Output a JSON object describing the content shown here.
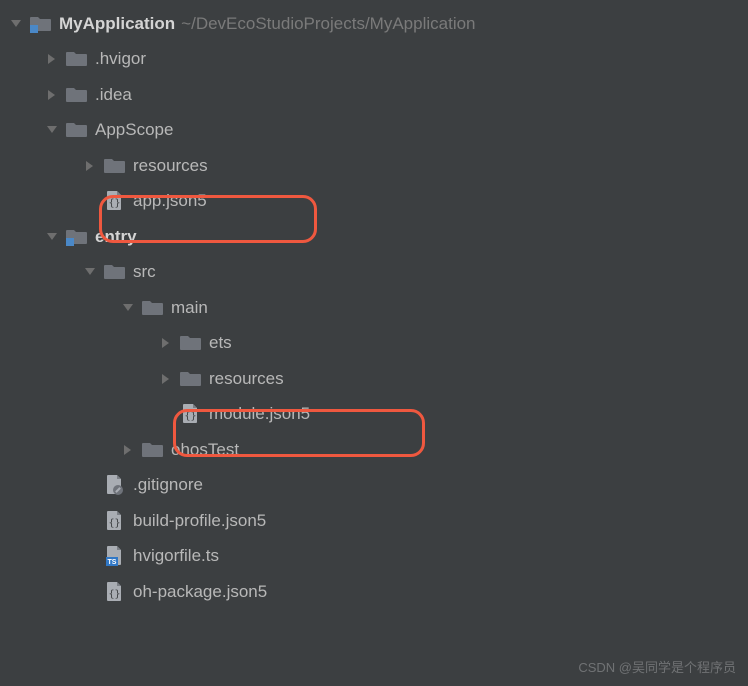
{
  "project": {
    "name": "MyApplication",
    "path": "~/DevEcoStudioProjects/MyApplication"
  },
  "tree": {
    "hvigor": ".hvigor",
    "idea": ".idea",
    "appscope": "AppScope",
    "appscope_resources": "resources",
    "app_json5": "app.json5",
    "entry": "entry",
    "src": "src",
    "main": "main",
    "ets": "ets",
    "main_resources": "resources",
    "module_json5": "module.json5",
    "ohosTest": "ohosTest",
    "gitignore": ".gitignore",
    "build_profile": "build-profile.json5",
    "hvigorfile": "hvigorfile.ts",
    "oh_package": "oh-package.json5"
  },
  "watermark": "CSDN @吴同学是个程序员"
}
